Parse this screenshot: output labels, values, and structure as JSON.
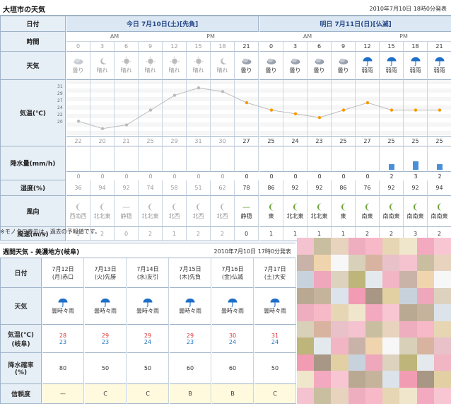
{
  "page": {
    "title": "大垣市の天気",
    "published": "2010年7月10日 18時0分発表"
  },
  "colors": {
    "header_bg": "#dbe7f3",
    "label_bg": "#e6eef6",
    "temp_line": "#f59a00",
    "rain_bar": "#4a90d9"
  },
  "hourly": {
    "labels": {
      "date": "日付",
      "time": "時間",
      "weather": "天気",
      "temp": "気温(℃)",
      "precip": "降水量(mm/h)",
      "humidity": "湿度(%)",
      "wind_dir": "風向",
      "wind_speed": "風速(m/s)"
    },
    "today": "今日 7月10日(土)[先負]",
    "tomorrow": "明日 7月11日(日)[仏滅]",
    "am": "AM",
    "pm": "PM",
    "hours": [
      "0",
      "3",
      "6",
      "9",
      "12",
      "15",
      "18",
      "21",
      "0",
      "3",
      "6",
      "9",
      "12",
      "15",
      "18",
      "21"
    ],
    "weather": [
      "曇り",
      "晴れ",
      "晴れ",
      "晴れ",
      "晴れ",
      "晴れ",
      "晴れ",
      "曇り",
      "曇り",
      "曇り",
      "曇り",
      "曇り",
      "弱雨",
      "弱雨",
      "弱雨",
      "弱雨"
    ],
    "weather_icons": [
      "cloudy-icon",
      "moon-icon",
      "sun-icon",
      "sun-icon",
      "sun-icon",
      "sun-icon",
      "moon-icon",
      "cloudy-icon",
      "cloudy-icon",
      "cloudy-icon",
      "cloudy-icon",
      "cloudy-icon",
      "rain-icon",
      "rain-icon",
      "rain-icon",
      "rain-icon"
    ],
    "temp_axis": [
      "31",
      "29",
      "27",
      "24",
      "22",
      "20"
    ],
    "temps": [
      22,
      20,
      21,
      25,
      29,
      31,
      30,
      27,
      25,
      24,
      23,
      25,
      27,
      25,
      25,
      25
    ],
    "precip": [
      "0",
      "0",
      "0",
      "0",
      "0",
      "0",
      "0",
      "0",
      "0",
      "0",
      "0",
      "0",
      "0",
      "2",
      "3",
      "2"
    ],
    "humidity": [
      "36",
      "94",
      "92",
      "74",
      "58",
      "51",
      "62",
      "78",
      "86",
      "92",
      "92",
      "86",
      "76",
      "92",
      "92",
      "94"
    ],
    "wind_dir": [
      "西南西",
      "北北東",
      "静穏",
      "北北東",
      "北西",
      "北西",
      "北西",
      "静穏",
      "東",
      "北北東",
      "北北東",
      "東",
      "南東",
      "南南東",
      "南南東",
      "南南東"
    ],
    "wind_speed": [
      "1",
      "2",
      "0",
      "2",
      "1",
      "2",
      "2",
      "0",
      "1",
      "1",
      "1",
      "1",
      "2",
      "2",
      "3",
      "2"
    ],
    "past_count": 7
  },
  "note": "※モノクロ表示は、過去の予報値です。",
  "weekly": {
    "title": "週間天気 - 美濃地方(岐阜)",
    "published": "2010年7月10日 17時0分発表",
    "labels": {
      "date": "日付",
      "weather": "天気",
      "temp1": "気温(℃)",
      "temp2": "(岐阜)",
      "rain1": "降水確率",
      "rain2": "(%)",
      "reliability": "信頼度"
    },
    "days": [
      {
        "date": "7月12日",
        "wd": "(月)赤口",
        "weather": "曇時々雨",
        "hi": "28",
        "lo": "23",
        "pop": "80",
        "rel": "—"
      },
      {
        "date": "7月13日",
        "wd": "(火)先勝",
        "weather": "曇時々雨",
        "hi": "29",
        "lo": "23",
        "pop": "50",
        "rel": "C"
      },
      {
        "date": "7月14日",
        "wd": "(水)友引",
        "weather": "曇時々雨",
        "hi": "29",
        "lo": "24",
        "pop": "50",
        "rel": "C"
      },
      {
        "date": "7月15日",
        "wd": "(木)先負",
        "weather": "曇時々雨",
        "hi": "29",
        "lo": "23",
        "pop": "60",
        "rel": "B"
      },
      {
        "date": "7月16日",
        "wd": "(金)仏滅",
        "weather": "曇時々雨",
        "hi": "30",
        "lo": "24",
        "pop": "60",
        "rel": "B"
      },
      {
        "date": "7月17日",
        "wd": "(土)大安",
        "weather": "曇時々雨",
        "hi": "31",
        "lo": "24",
        "pop": "50",
        "rel": "C"
      }
    ]
  }
}
